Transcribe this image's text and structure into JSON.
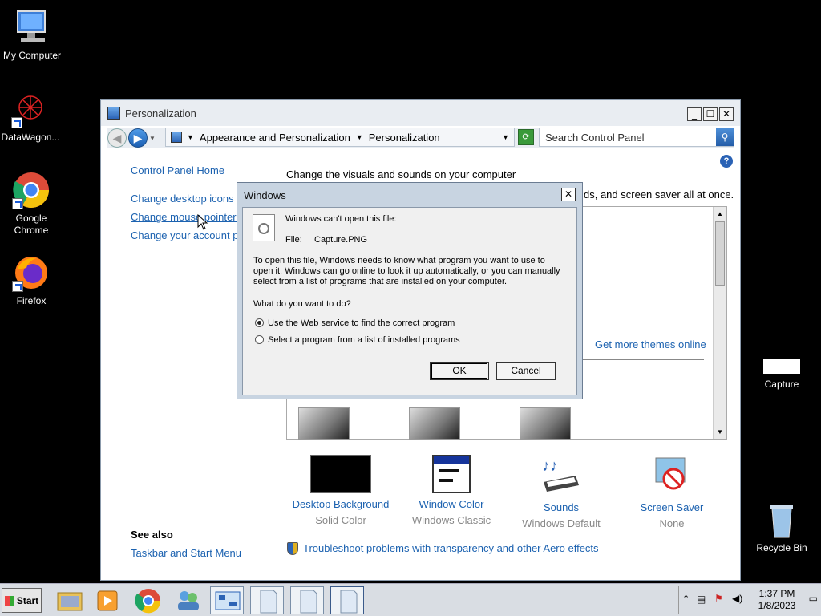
{
  "desktop": {
    "icons": [
      {
        "label": "My Computer"
      },
      {
        "label": "DataWagon..."
      },
      {
        "label": "Google Chrome"
      },
      {
        "label": "Firefox"
      },
      {
        "label": "Capture"
      },
      {
        "label": "Recycle Bin"
      }
    ]
  },
  "cp_window": {
    "title": "Personalization",
    "controls": {
      "minimize": "_",
      "maximize": "☐",
      "close": "✕"
    },
    "breadcrumb": [
      "Appearance and Personalization",
      "Personalization"
    ],
    "search_placeholder": "Search Control Panel",
    "left_links": [
      "Control Panel Home",
      "Change desktop icons",
      "Change mouse pointers",
      "Change your account pic"
    ],
    "heading": "Change the visuals and sounds on your computer",
    "subheading_fragment": "ds, and screen saver all at once.",
    "more_themes_link": "Get more themes online",
    "tiles": [
      {
        "label": "Desktop Background",
        "sub": "Solid Color"
      },
      {
        "label": "Window Color",
        "sub": "Windows Classic"
      },
      {
        "label": "Sounds",
        "sub": "Windows Default"
      },
      {
        "label": "Screen Saver",
        "sub": "None"
      }
    ],
    "see_also": {
      "title": "See also",
      "links": [
        "Taskbar and Start Menu"
      ]
    },
    "troubleshoot_link": "Troubleshoot problems with transparency and other Aero effects"
  },
  "dialog": {
    "title": "Windows",
    "close": "✕",
    "cant_open": "Windows can't open this file:",
    "file_label": "File:",
    "file_name": "Capture.PNG",
    "explain_1": "To open this file, Windows needs to know what program you want to use to",
    "explain_2": "open it. Windows can go online to look it up automatically, or you can manually",
    "explain_3": "select from a list of programs that are installed on your computer.",
    "question": "What do you want to do?",
    "options": [
      {
        "label": "Use the Web service to find the correct program",
        "selected": true
      },
      {
        "label": "Select a program from a list of installed programs",
        "selected": false
      }
    ],
    "ok": "OK",
    "cancel": "Cancel"
  },
  "taskbar": {
    "start": "Start",
    "clock_time": "1:37 PM",
    "clock_date": "1/8/2023"
  },
  "colors": {
    "link": "#1c62b0",
    "desktop": "#000000"
  }
}
